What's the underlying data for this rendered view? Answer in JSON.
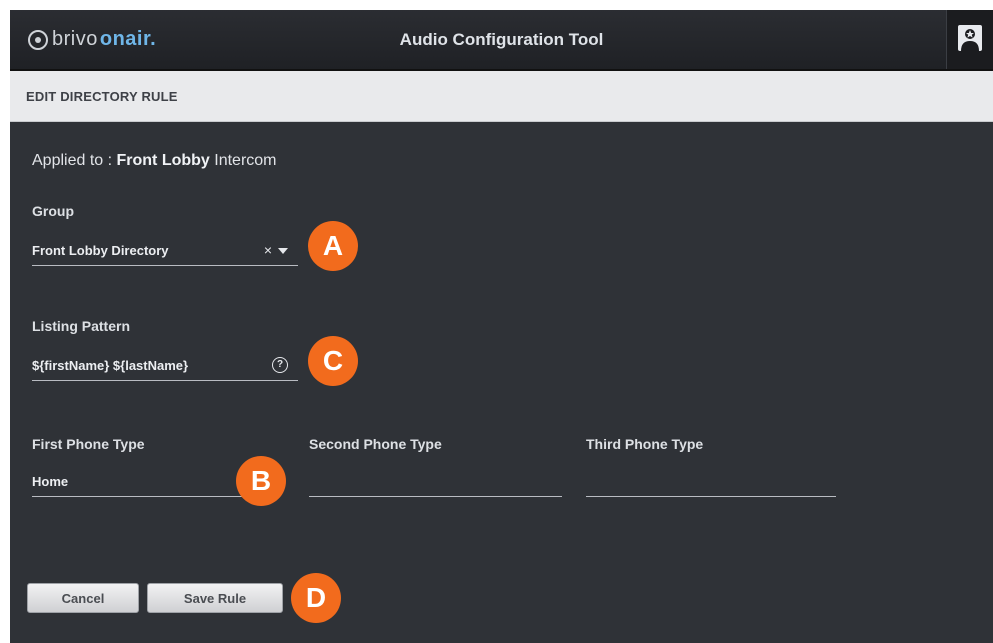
{
  "header": {
    "logo_brand": "brivo",
    "logo_product": "onair.",
    "title": "Audio Configuration Tool",
    "user_icon": "user-badge-icon"
  },
  "subheader": {
    "title": "EDIT DIRECTORY RULE"
  },
  "applied": {
    "prefix": "Applied to : ",
    "target_bold": "Front Lobby",
    "target_rest": " Intercom"
  },
  "group": {
    "label": "Group",
    "value": "Front Lobby Directory",
    "clear_symbol": "×"
  },
  "listing": {
    "label": "Listing Pattern",
    "value": "${firstName} ${lastName}",
    "help_symbol": "?"
  },
  "phones": {
    "first_label": "First Phone Type",
    "first_value": "Home",
    "second_label": "Second Phone Type",
    "second_value": "",
    "third_label": "Third Phone Type",
    "third_value": ""
  },
  "buttons": {
    "cancel": "Cancel",
    "save": "Save Rule"
  },
  "callouts": {
    "a": "A",
    "b": "B",
    "c": "C",
    "d": "D"
  },
  "colors": {
    "callout": "#f26b1d",
    "background": "#2f3237",
    "accent": "#6fb6e8"
  }
}
